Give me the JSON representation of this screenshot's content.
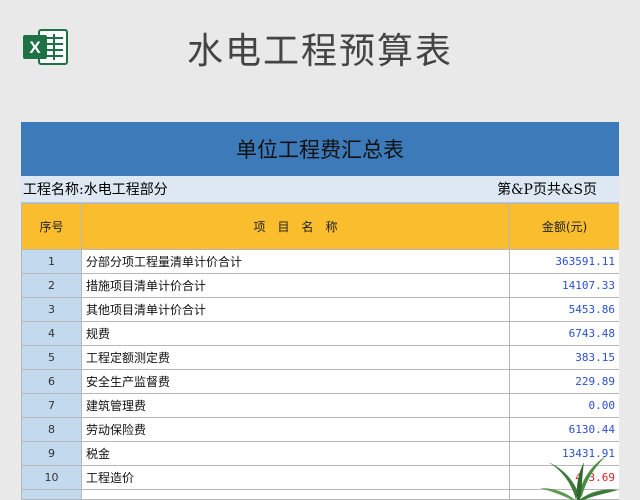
{
  "header": {
    "title": "水电工程预算表",
    "icon": "excel-icon",
    "icon_letter": "X",
    "icon_color": "#1e7145"
  },
  "sheet": {
    "title": "单位工程费汇总表",
    "project_label": "工程名称:水电工程部分",
    "page_info": "第&P页共&S页",
    "columns": [
      "序号",
      "项　目　名　称",
      "金额(元)"
    ],
    "rows": [
      {
        "no": "1",
        "name": "分部分项工程量清单计价合计",
        "amount": "363591.11"
      },
      {
        "no": "2",
        "name": "措施项目清单计价合计",
        "amount": "14107.33"
      },
      {
        "no": "3",
        "name": "其他项目清单计价合计",
        "amount": "5453.86"
      },
      {
        "no": "4",
        "name": "规费",
        "amount": "6743.48"
      },
      {
        "no": "5",
        "name": "工程定额测定费",
        "amount": "383.15"
      },
      {
        "no": "6",
        "name": "安全生产监督费",
        "amount": "229.89"
      },
      {
        "no": "7",
        "name": "建筑管理费",
        "amount": "0.00"
      },
      {
        "no": "8",
        "name": "劳动保险费",
        "amount": "6130.44"
      },
      {
        "no": "9",
        "name": "税金",
        "amount": "13431.91"
      },
      {
        "no": "10",
        "name": "工程造价",
        "amount": "4 3.69"
      }
    ],
    "colors": {
      "title_bar": "#3d7ab9",
      "info_bar": "#dde8f3",
      "header_row": "#f9bd2e",
      "number_column": "#c3d9ee",
      "amount_text": "#2b4fd1",
      "total_amount_text": "#e02020"
    }
  }
}
